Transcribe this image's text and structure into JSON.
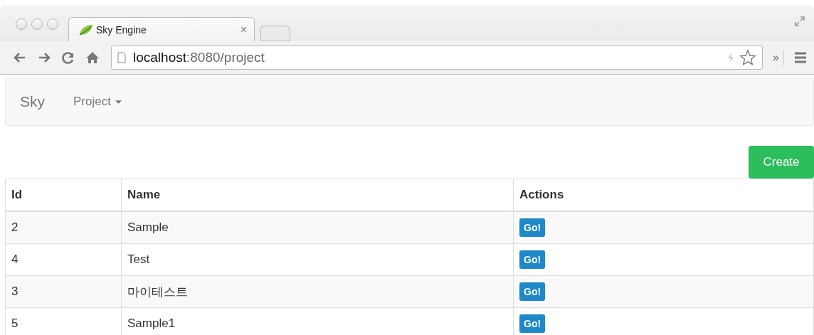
{
  "browser": {
    "tab": {
      "title": "Sky Engine",
      "close": "×"
    },
    "url": {
      "host": "localhost",
      "path": ":8080/project"
    },
    "extensions": "»"
  },
  "navbar": {
    "brand": "Sky",
    "menu": "Project"
  },
  "create_button": "Create",
  "table": {
    "columns": [
      "Id",
      "Name",
      "Actions"
    ],
    "rows": [
      {
        "id": "2",
        "name": "Sample",
        "action": "Go!"
      },
      {
        "id": "4",
        "name": "Test",
        "action": "Go!"
      },
      {
        "id": "3",
        "name": "마이테스트",
        "action": "Go!"
      },
      {
        "id": "5",
        "name": "Sample1",
        "action": "Go!"
      }
    ]
  }
}
